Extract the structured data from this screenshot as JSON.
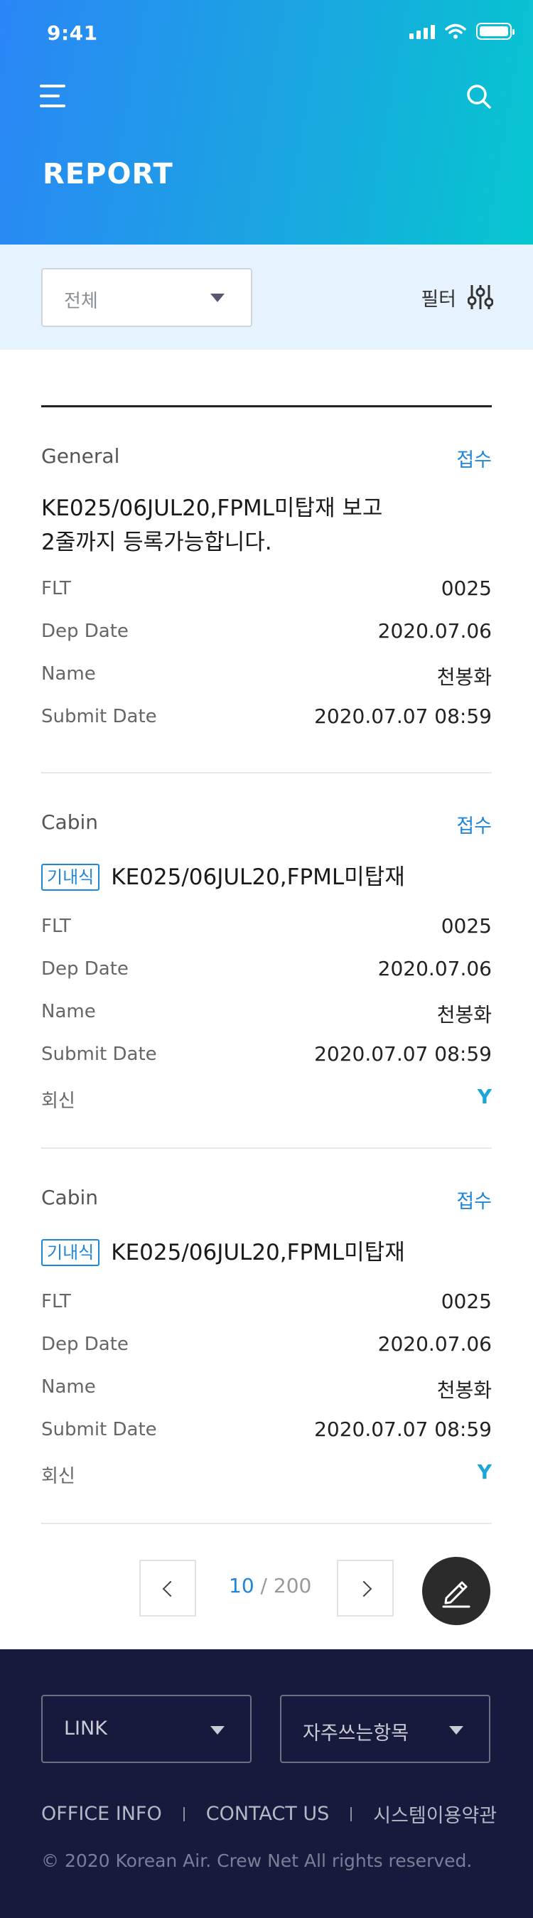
{
  "status_bar": {
    "time": "9:41"
  },
  "header": {
    "title": "REPORT",
    "menu_icon": "hamburger-menu-icon",
    "search_icon": "search-icon"
  },
  "filter_bar": {
    "select_value": "전체",
    "filter_label": "필터",
    "filter_icon": "sliders-icon"
  },
  "reports": [
    {
      "category": "General",
      "status": "접수",
      "title_lines": [
        "KE025/06JUL20,FPML미탑재 보고",
        "2줄까지 등록가능합니다."
      ],
      "fields": [
        {
          "label": "FLT",
          "value": "0025"
        },
        {
          "label": "Dep Date",
          "value": "2020.07.06"
        },
        {
          "label": "Name",
          "value": "천봉화"
        },
        {
          "label": "Submit Date",
          "value": "2020.07.07 08:59"
        }
      ]
    },
    {
      "category": "Cabin",
      "status": "접수",
      "tag": "기내식",
      "title": "KE025/06JUL20,FPML미탑재",
      "fields": [
        {
          "label": "FLT",
          "value": "0025"
        },
        {
          "label": "Dep Date",
          "value": "2020.07.06"
        },
        {
          "label": "Name",
          "value": "천봉화"
        },
        {
          "label": "Submit Date",
          "value": "2020.07.07 08:59"
        },
        {
          "label": "회신",
          "value": "Y"
        }
      ]
    },
    {
      "category": "Cabin",
      "status": "접수",
      "tag": "기내식",
      "title": "KE025/06JUL20,FPML미탑재",
      "fields": [
        {
          "label": "FLT",
          "value": "0025"
        },
        {
          "label": "Dep Date",
          "value": "2020.07.06"
        },
        {
          "label": "Name",
          "value": "천봉화"
        },
        {
          "label": "Submit Date",
          "value": "2020.07.07 08:59"
        },
        {
          "label": "회신",
          "value": "Y"
        }
      ]
    }
  ],
  "pagination": {
    "current": "10",
    "separator": " / ",
    "total": "200"
  },
  "fab": {
    "icon": "pencil-icon"
  },
  "footer": {
    "link_select": "LINK",
    "favorites_select": "자주쓰는항목",
    "links": [
      "OFFICE INFO",
      "CONTACT US",
      "시스템이용약관"
    ],
    "copyright": "© 2020 Korean Air. Crew Net  All rights reserved."
  },
  "colors": {
    "accent": "#1f86d9",
    "header_start": "#2a86f6",
    "header_end": "#05c7cf",
    "footer_bg": "#171a3d"
  }
}
